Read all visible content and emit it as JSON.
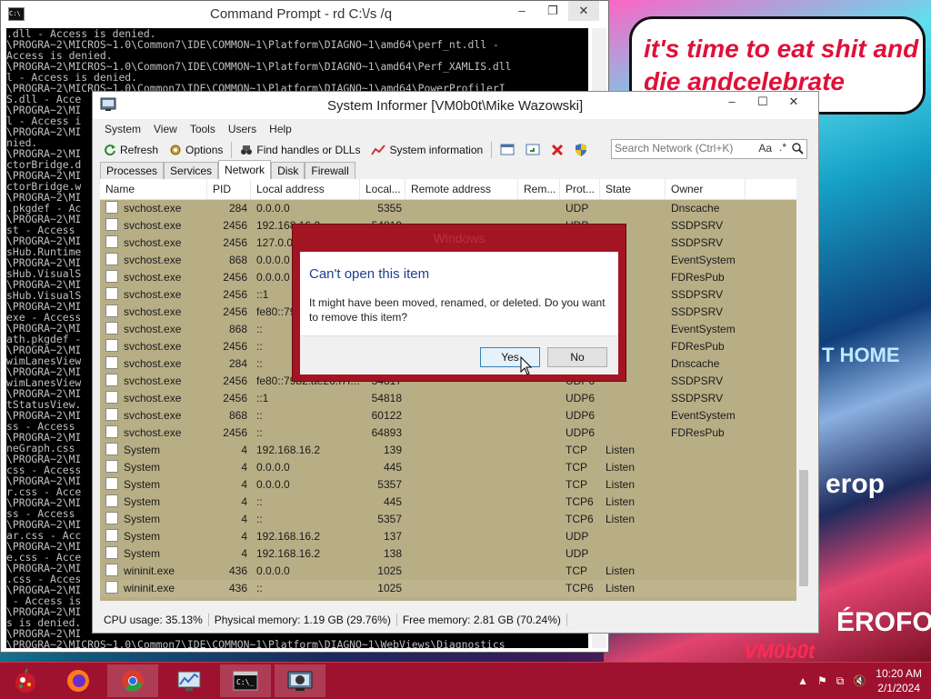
{
  "desktop": {
    "bubble_text": "it's time to eat shit and die andcelebrate",
    "deco_1": "T HOME",
    "deco_2": "erop",
    "deco_3": "ÉROFO",
    "deco_4": "VM0b0t"
  },
  "cmd": {
    "title": "Command Prompt - rd  C:\\/s /q",
    "controls": [
      "–",
      "❐",
      "✕"
    ],
    "lines": [
      ".dll - Access is denied.",
      "\\PROGRA~2\\MICROS~1.0\\Common7\\IDE\\COMMON~1\\Platform\\DIAGNO~1\\amd64\\perf_nt.dll -",
      "Access is denied.",
      "\\PROGRA~2\\MICROS~1.0\\Common7\\IDE\\COMMON~1\\Platform\\DIAGNO~1\\amd64\\Perf_XAMLIS.dll",
      "l - Access is denied.",
      "\\PROGRA~2\\MICROS~1.0\\Common7\\IDE\\COMMON~1\\Platform\\DIAGNO~1\\amd64\\PowerProfilerI",
      "S.dll - Acce",
      "\\PROGRA~2\\MI",
      "l - Access i",
      "\\PROGRA~2\\MI",
      "nied.",
      "\\PROGRA~2\\MI",
      "ctorBridge.d",
      "\\PROGRA~2\\MI",
      "ctorBridge.w",
      "\\PROGRA~2\\MI",
      ".pkgdef - Ac",
      "\\PROGRA~2\\MI",
      "st - Access",
      "\\PROGRA~2\\MI",
      "sHub.Runtime",
      "\\PROGRA~2\\MI",
      "sHub.VisualS",
      "\\PROGRA~2\\MI",
      "sHub.VisualS",
      "\\PROGRA~2\\MI",
      "exe - Access",
      "\\PROGRA~2\\MI",
      "ath.pkgdef -",
      "\\PROGRA~2\\MI",
      "wimLanesView",
      "\\PROGRA~2\\MI",
      "wimLanesView",
      "\\PROGRA~2\\MI",
      "tStatusView.",
      "\\PROGRA~2\\MI",
      "ss - Access",
      "\\PROGRA~2\\MI",
      "neGraph.css",
      "\\PROGRA~2\\MI",
      "css - Access",
      "\\PROGRA~2\\MI",
      "r.css - Acce",
      "\\PROGRA~2\\MI",
      "ss - Access",
      "\\PROGRA~2\\MI",
      "ar.css - Acc",
      "\\PROGRA~2\\MI",
      "e.css - Acce",
      "\\PROGRA~2\\MI",
      ".css - Acces",
      "\\PROGRA~2\\MI",
      " - Access is",
      "\\PROGRA~2\\MI",
      "s is denied.",
      "\\PROGRA~2\\MI",
      "\\PROGRA~2\\MICROS~1.0\\Common7\\IDE\\COMMON~1\\Platform\\DIAGNO~1\\WebViews\\Diagnostics"
    ]
  },
  "si": {
    "title": "System Informer [VM0b0t\\Mike Wazowski]",
    "menu": [
      "System",
      "View",
      "Tools",
      "Users",
      "Help"
    ],
    "toolbar": {
      "refresh": "Refresh",
      "options": "Options",
      "find": "Find handles or DLLs",
      "sysinfo": "System information"
    },
    "search_placeholder": "Search Network (Ctrl+K)",
    "search_suffix": "Aa",
    "tabs": [
      "Processes",
      "Services",
      "Network",
      "Disk",
      "Firewall"
    ],
    "selected_tab": "Network",
    "columns": [
      "Name",
      "PID",
      "Local address",
      "Local...",
      "Remote address",
      "Rem...",
      "Prot...",
      "State",
      "Owner"
    ],
    "rows": [
      [
        "svchost.exe",
        "284",
        "0.0.0.0",
        "5355",
        "",
        "",
        "UDP",
        "",
        "Dnscache"
      ],
      [
        "svchost.exe",
        "2456",
        "192.168.16.2",
        "54819",
        "",
        "",
        "UDP",
        "",
        "SSDPSRV"
      ],
      [
        "svchost.exe",
        "2456",
        "127.0.0.1",
        "",
        "",
        "",
        "",
        "",
        "SSDPSRV"
      ],
      [
        "svchost.exe",
        "868",
        "0.0.0.0",
        "",
        "",
        "",
        "",
        "",
        "EventSystem"
      ],
      [
        "svchost.exe",
        "2456",
        "0.0.0.0",
        "",
        "",
        "",
        "",
        "",
        "FDResPub"
      ],
      [
        "svchost.exe",
        "2456",
        "::1",
        "",
        "",
        "",
        "",
        "",
        "SSDPSRV"
      ],
      [
        "svchost.exe",
        "2456",
        "fe80::79b2:",
        "",
        "",
        "",
        "",
        "",
        "SSDPSRV"
      ],
      [
        "svchost.exe",
        "868",
        "::",
        "",
        "",
        "",
        "",
        "",
        "EventSystem"
      ],
      [
        "svchost.exe",
        "2456",
        "::",
        "",
        "",
        "",
        "",
        "",
        "FDResPub"
      ],
      [
        "svchost.exe",
        "284",
        "::",
        "",
        "",
        "",
        "",
        "",
        "Dnscache"
      ],
      [
        "svchost.exe",
        "2456",
        "fe80::79b2:ae26:f7f...",
        "54817",
        "",
        "",
        "UDP6",
        "",
        "SSDPSRV"
      ],
      [
        "svchost.exe",
        "2456",
        "::1",
        "54818",
        "",
        "",
        "UDP6",
        "",
        "SSDPSRV"
      ],
      [
        "svchost.exe",
        "868",
        "::",
        "60122",
        "",
        "",
        "UDP6",
        "",
        "EventSystem"
      ],
      [
        "svchost.exe",
        "2456",
        "::",
        "64893",
        "",
        "",
        "UDP6",
        "",
        "FDResPub"
      ],
      [
        "System",
        "4",
        "192.168.16.2",
        "139",
        "",
        "",
        "TCP",
        "Listen",
        ""
      ],
      [
        "System",
        "4",
        "0.0.0.0",
        "445",
        "",
        "",
        "TCP",
        "Listen",
        ""
      ],
      [
        "System",
        "4",
        "0.0.0.0",
        "5357",
        "",
        "",
        "TCP",
        "Listen",
        ""
      ],
      [
        "System",
        "4",
        "::",
        "445",
        "",
        "",
        "TCP6",
        "Listen",
        ""
      ],
      [
        "System",
        "4",
        "::",
        "5357",
        "",
        "",
        "TCP6",
        "Listen",
        ""
      ],
      [
        "System",
        "4",
        "192.168.16.2",
        "137",
        "",
        "",
        "UDP",
        "",
        ""
      ],
      [
        "System",
        "4",
        "192.168.16.2",
        "138",
        "",
        "",
        "UDP",
        "",
        ""
      ],
      [
        "wininit.exe",
        "436",
        "0.0.0.0",
        "1025",
        "",
        "",
        "TCP",
        "Listen",
        ""
      ],
      [
        "wininit.exe",
        "436",
        "::",
        "1025",
        "",
        "",
        "TCP6",
        "Listen",
        ""
      ]
    ],
    "status": {
      "cpu": "CPU usage: 35.13%",
      "phys": "Physical memory: 1.19 GB (29.76%)",
      "free": "Free memory: 2.81 GB (70.24%)"
    }
  },
  "dialog": {
    "title": "Windows",
    "heading": "Can't open this item",
    "message": "It might have been moved, renamed, or deleted. Do you want to remove this item?",
    "yes": "Yes",
    "no": "No"
  },
  "taskbar": {
    "time": "10:20 AM",
    "date": "2/1/2024"
  }
}
